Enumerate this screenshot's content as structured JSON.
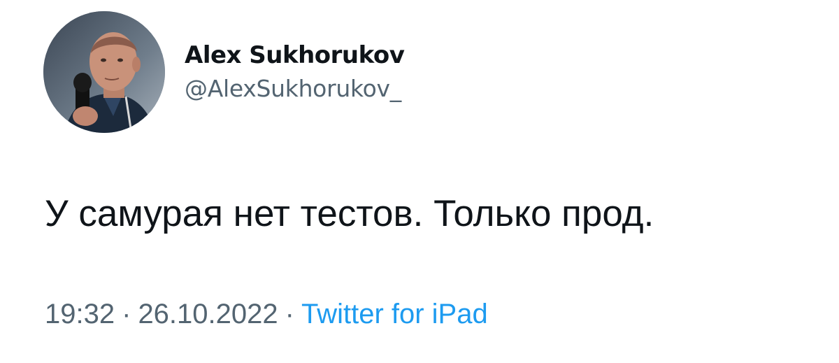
{
  "tweet": {
    "author": {
      "display_name": "Alex Sukhorukov",
      "handle": "@AlexSukhorukov_",
      "avatar_icon": "avatar-photo"
    },
    "text": "У самурая нет тестов. Только прод.",
    "meta": {
      "time": "19:32",
      "separator": "·",
      "date": "26.10.2022",
      "source": "Twitter for iPad"
    }
  },
  "colors": {
    "text_primary": "#0f1419",
    "text_secondary": "#536471",
    "link": "#1d9bf0",
    "background": "#ffffff"
  }
}
